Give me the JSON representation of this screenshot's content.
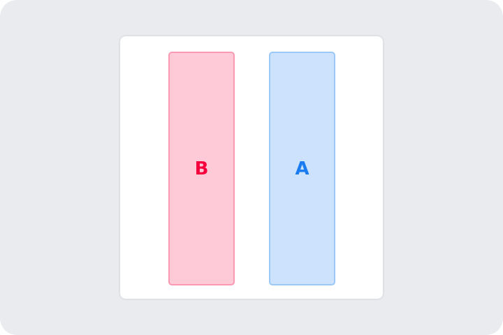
{
  "panels": [
    {
      "label": "B",
      "fill": "#ffcad7",
      "border": "#f99ab2",
      "text_color": "#f5003d"
    },
    {
      "label": "A",
      "fill": "#cde2fd",
      "border": "#9bc8f7",
      "text_color": "#1a7cf0"
    }
  ]
}
